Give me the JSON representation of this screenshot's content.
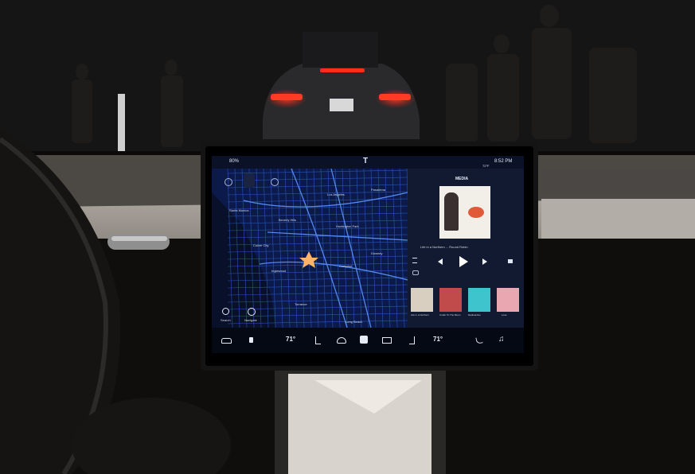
{
  "screen": {
    "status": {
      "logo": "T",
      "battery_text": "80%",
      "clock": "8:52 PM",
      "temperature": "72°F"
    },
    "map": {
      "cities": [
        "Los Angeles",
        "Beverly Hills",
        "Culver City",
        "Inglewood",
        "Long Beach",
        "Torrance",
        "Compton",
        "Downey",
        "Huntington Park",
        "Pasadena",
        "Santa Monica"
      ],
      "search_label": "Search",
      "nav_label": "Navigate"
    },
    "media": {
      "header": "MEDIA",
      "track": "Life in a Northern ... Round Robin",
      "album_tiles": [
        "Life in a Northern",
        "Under To The Moon",
        "Radioactive",
        "Lose"
      ]
    },
    "bottom_bar": {
      "driver_temp": "71°",
      "passenger_temp": "71°"
    }
  },
  "colors": {
    "map_background": "#0b1a4a",
    "map_roads": "#3c7cff",
    "media_background": "#111a30",
    "tail_lights": "#ff2a1f",
    "screen_bezel": "#141414"
  },
  "icons": [
    "tesla-logo-icon",
    "car-icon",
    "lock-icon",
    "seat-heater-icon",
    "defrost-icon",
    "fan-icon",
    "phone-icon",
    "music-note-icon",
    "previous-track-icon",
    "play-icon",
    "next-track-icon",
    "shuffle-icon",
    "repeat-icon",
    "volume-icon",
    "search-icon",
    "navigation-icon"
  ]
}
